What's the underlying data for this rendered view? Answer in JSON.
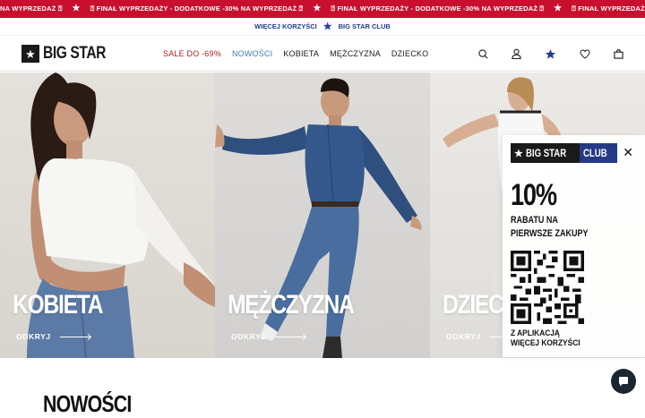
{
  "ticker": {
    "segments": [
      {
        "pre": "NA WYPRZEDAŻ ",
        "box": "?"
      },
      {
        "pre": "",
        "box": "?",
        "text": " FINAŁ WYPRZEDAŻY - DODATKOWE -30% NA WYPRZEDAŻ ",
        "box2": "?"
      },
      {
        "pre": "",
        "box": "?",
        "text": " FINAŁ WYPRZEDAŻY - DODATKOWE -30% NA WYPRZEDAŻ ",
        "box2": "?"
      },
      {
        "pre": "",
        "box": "?",
        "text": " FINAŁ WYPRZEDAŻY"
      }
    ],
    "t1": "NA WYPRZEDAŻ ⍰",
    "t2": "⍰ FINAŁ WYPRZEDAŻY - DODATKOWE -30% NA WYPRZEDAŻ ⍰",
    "t3": "⍰ FINAŁ WYPRZEDAŻY - DODATKOWE -30% NA WYPRZEDAŻ ⍰",
    "t4": "⍰ FINAŁ WYPRZEDAŻY"
  },
  "benefits": {
    "more_benefits": "WIĘCEJ KORZYŚCI",
    "club": "BIG STAR CLUB"
  },
  "header": {
    "logo_text": "BIG STAR",
    "nav": {
      "sale": "SALE DO -69%",
      "new": "NOWOŚCI",
      "women": "KOBIETA",
      "men": "MĘŻCZYZNA",
      "kids": "DZIECKO"
    }
  },
  "hero": {
    "panels": [
      {
        "title": "KOBIETA",
        "link": "ODKRYJ"
      },
      {
        "title": "MĘŻCZYZNA",
        "link": "ODKRYJ"
      },
      {
        "title": "DZIECKO",
        "link": "ODKRYJ"
      }
    ]
  },
  "club_popup": {
    "logo_left": "BIG STAR",
    "logo_right": "CLUB",
    "percent": "10%",
    "line1": "RABATU NA",
    "line2": "PIERWSZE ZAKUPY",
    "app1": "Z APLIKACJĄ",
    "app2": "WIĘCEJ KORZYŚCI"
  },
  "section": {
    "title": "NOWOŚCI"
  },
  "colors": {
    "ticker_bg": "#c8102e",
    "accent_blue": "#1d3f8a",
    "sale_red": "#b01f24",
    "new_blue": "#3e7bbf"
  },
  "icons": [
    "star-icon",
    "search-icon",
    "account-icon",
    "club-star-icon",
    "heart-icon",
    "bag-icon",
    "close-icon",
    "chat-icon"
  ]
}
